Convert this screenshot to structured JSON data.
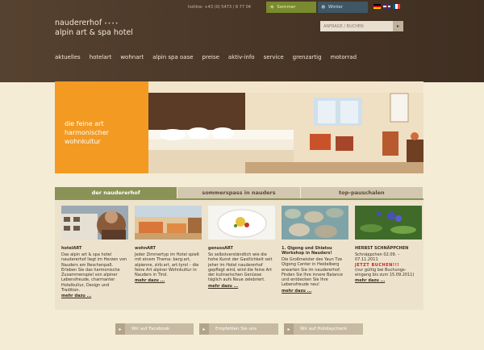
{
  "topbar": {
    "hotline": "hotline: +43 (0) 5473 / 8 77 04",
    "summer": "Sommer",
    "winter": "Winter"
  },
  "logo": {
    "name": "naudererhof",
    "stars": "••••",
    "subtitle": "alpin art & spa hotel"
  },
  "request": {
    "label": "ANFRAGE / BUCHEN",
    "go": "▸"
  },
  "nav": [
    "aktuelles",
    "hotelart",
    "wohnart",
    "alpin spa oase",
    "preise",
    "aktiv-info",
    "service",
    "grenzartig",
    "motorrad"
  ],
  "hero": {
    "line1": "die feine art",
    "line2": "harmonischer",
    "line3": "wohnkultur"
  },
  "tabs": [
    "der naudererhof",
    "sommerspass in nauders",
    "top-pauschalen"
  ],
  "columns": [
    {
      "title": "hotelART",
      "text": "Das alpin art & spa hotel naudererhof liegt im Herzen von Nauders am Reschenpaß. Erleben Sie das harmonische Zusammenspiel von alpiner Lebensfreude, charmanter Hotelkultur, Design und Tradition.",
      "more": "mehr dazu ..."
    },
    {
      "title": "wohnART",
      "text": "Jeder Zimmertyp im Hotel spielt mit einem Thema: berg:art, alpienne, zirb:art, art:tyrol – die feine Art alpiner Wohnkultur in Nauders in Tirol.",
      "more": "mehr dazu ..."
    },
    {
      "title": "genussART",
      "text": "So selbstverständlich wie die hohe Kunst der Gastlichkeit seit jeher im Hotel naudererhof gepflegt wird, wird die feine Art der kulinarischen Genüsse täglich aufs Neue zelebriert.",
      "more": "mehr dazu ..."
    },
    {
      "title": "1. Qigong und Shiatsu",
      "title2": "Workshop in Nauders!",
      "text": "Die Großmeister des Yaun Tze Qigong Center in Heidelberg erwarten Sie im naudererhof. Finden Sie Ihre innere Balance und entdecken Sie Ihre Lebensfreude neu!",
      "more": "mehr dazu ..."
    },
    {
      "title": "HERBST SCHNÄPPCHEN",
      "text": "Schnäppchen 02.09. – 07.11.2011",
      "highlight": "JETZT BUCHEN!!!",
      "text2": "(nur gültig bei Buchungs-eingang bis zum 15.09.2011)",
      "more": "mehr dazu ..."
    }
  ],
  "social": [
    "Wir auf Facebook",
    "Empfehlen Sie uns",
    "Wir auf Holidaycheck"
  ]
}
